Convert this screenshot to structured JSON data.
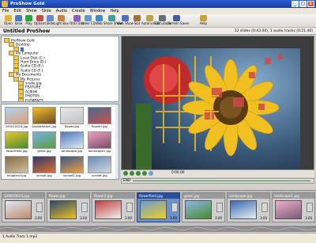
{
  "window": {
    "title": "ProShow Gold",
    "controls": [
      "_",
      "□",
      "x"
    ]
  },
  "menu": [
    "File",
    "Edit",
    "Show",
    "Slide",
    "Audio",
    "Create",
    "Window",
    "Help"
  ],
  "toolbar": [
    {
      "label": "Open",
      "icon": "folder-open-icon",
      "color": "#e0b040"
    },
    {
      "label": "Save",
      "icon": "save-icon",
      "color": "#4a78c8"
    },
    {
      "label": "Play",
      "icon": "play-icon",
      "color": "#30a040"
    },
    {
      "label": "Options",
      "icon": "options-icon",
      "color": "#c05050"
    },
    {
      "label": "Slide",
      "icon": "slide-icon",
      "color": "#6a8ad0"
    },
    {
      "label": "Light Box",
      "icon": "lightbox-icon",
      "color": "#d08040"
    },
    {
      "label": "DVD Disc",
      "icon": "dvd-icon",
      "color": "#8a5ac8"
    },
    {
      "label": "Video CD",
      "icon": "video-cd-icon",
      "color": "#5a9ad0"
    },
    {
      "label": "Web",
      "icon": "web-icon",
      "color": "#3a8ad0"
    },
    {
      "label": "Share Show",
      "icon": "share-icon",
      "color": "#40a0a0"
    },
    {
      "label": "Web Show",
      "icon": "web-show-icon",
      "color": "#5070c0"
    },
    {
      "label": "Slot",
      "icon": "slot-icon",
      "color": "#a07040"
    },
    {
      "label": "Autorun CD",
      "icon": "autorun-cd-icon",
      "color": "#c0a040"
    },
    {
      "label": "Executable",
      "icon": "executable-icon",
      "color": "#607080"
    },
    {
      "label": "Screen Saver",
      "icon": "screen-saver-icon",
      "color": "#4060a0"
    },
    {
      "label": "Help",
      "icon": "help-icon",
      "color": "#d0a030"
    }
  ],
  "show": {
    "title": "Untitled ProShow",
    "info": "12 slides (0:43.00), 1 audio tracks (0:21.40)"
  },
  "folders": [
    {
      "label": "ProShow Gold",
      "depth": 0
    },
    {
      "label": "Desktop",
      "depth": 1
    },
    {
      "label": "...",
      "depth": 2,
      "selected": true
    },
    {
      "label": "My Computer",
      "depth": 1
    },
    {
      "label": "Local Disk (C:)",
      "depth": 2
    },
    {
      "label": "Hard Drive (D:)",
      "depth": 2
    },
    {
      "label": "Audio CD (E:)",
      "depth": 2
    },
    {
      "label": "Audio CD (F:)",
      "depth": 2
    },
    {
      "label": "My Documents",
      "depth": 1
    },
    {
      "label": "My Pictures",
      "depth": 2
    },
    {
      "label": "snake.jpg",
      "depth": 3
    },
    {
      "label": "FEATURE",
      "depth": 3
    },
    {
      "label": "ALBUM",
      "depth": 3
    },
    {
      "label": "PHOTOS",
      "depth": 3
    },
    {
      "label": "ELEMENTS",
      "depth": 3
    }
  ],
  "thumbnails": [
    {
      "label": "100010024.jpg",
      "c1": "#b0d4ee",
      "c2": "#d8a07a"
    },
    {
      "label": "shutterstock.jpg",
      "c1": "#f0c030",
      "c2": "#6a4a20"
    },
    {
      "label": "flower.jpg",
      "c1": "#e8e8e8",
      "c2": "#c0c0c0"
    },
    {
      "label": "flowerr.jpg",
      "c1": "#4a6a8a",
      "c2": "#c85050"
    },
    {
      "label": "flowerfield.jpg",
      "c1": "#e8c830",
      "c2": "#4a8a30"
    },
    {
      "label": "grass.jpg",
      "c1": "#7ab0e0",
      "c2": "#5aa040"
    },
    {
      "label": "landscape.jpg",
      "c1": "#4a7ac0",
      "c2": "#e0e8f0"
    },
    {
      "label": "landscape1.jpg",
      "c1": "#f0a0c0",
      "c2": "#7a4a6a"
    },
    {
      "label": "kingpenz.jpg",
      "c1": "#8a6a4a",
      "c2": "#d0c0a0"
    },
    {
      "label": "sunset.jpg",
      "c1": "#2a3a6a",
      "c2": "#e07030"
    },
    {
      "label": "sunset1.jpg",
      "c1": "#3a5a8a",
      "c2": "#f0a040"
    },
    {
      "label": "sunset.jpg",
      "c1": "#6a8ab0",
      "c2": "#d0d8e0"
    }
  ],
  "transport": {
    "time": "0:00.00",
    "end": "END"
  },
  "slides": [
    {
      "head": "100010024.jpg",
      "c1": "#dfeaf2",
      "c2": "#c08a6a",
      "dur": "3.00"
    },
    {
      "head": "flower.jpg",
      "c1": "#2a4a70",
      "c2": "#f0c020",
      "dur": "3.00"
    },
    {
      "head": "flower2.jpg",
      "c1": "#c04040",
      "c2": "#f0f0f0",
      "dur": "3.00"
    },
    {
      "head": "flowerfield.jpg",
      "c1": "#6a9ad0",
      "c2": "#f0d020",
      "dur": "3.00",
      "selected": true
    },
    {
      "head": "grass.jpg",
      "c1": "#8ab8e0",
      "c2": "#4a8a30",
      "dur": "3.00"
    },
    {
      "head": "landscape.jpg",
      "c1": "#3a6ab0",
      "c2": "#e8eef4",
      "dur": "3.00"
    },
    {
      "head": "landscape1.jpg",
      "c1": "#f0b0c8",
      "c2": "#7a5a7a",
      "dur": "3.00"
    }
  ],
  "status": "1 Audio Track 1.mp3",
  "colors": {
    "accent": "#316ac5",
    "titlebar": "#1a3fa0"
  }
}
